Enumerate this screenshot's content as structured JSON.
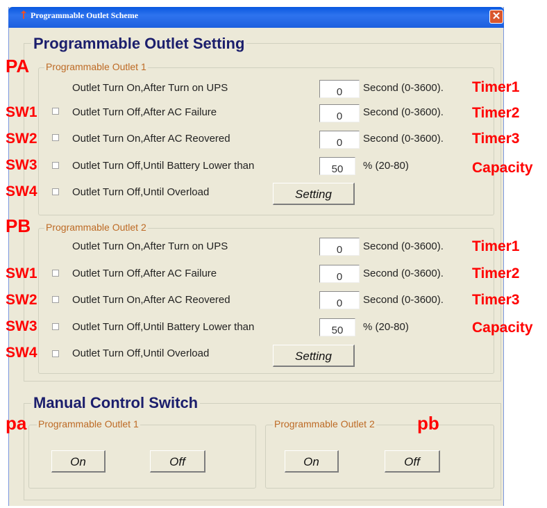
{
  "window": {
    "title": "Programmable Outlet Scheme",
    "close_glyph": "✕"
  },
  "setting": {
    "heading": "Programmable Outlet Setting",
    "outlets": [
      {
        "group_label": "Programmable Outlet 1",
        "turn_on_label": "Outlet Turn On,After Turn on UPS",
        "turn_on_value": "0",
        "turn_on_unit": "Second (0-3600).",
        "ac_fail_label": "Outlet Turn Off,After AC Failure",
        "ac_fail_value": "0",
        "ac_fail_unit": "Second (0-3600).",
        "ac_recover_label": "Outlet Turn On,After AC Reovered",
        "ac_recover_value": "0",
        "ac_recover_unit": "Second (0-3600).",
        "battery_label": "Outlet Turn Off,Until Battery Lower than",
        "battery_value": "50",
        "battery_unit": "% (20-80)",
        "overload_label": "Outlet Turn Off,Until Overload",
        "setting_button": "Setting"
      },
      {
        "group_label": "Programmable Outlet 2",
        "turn_on_label": "Outlet Turn On,After Turn on UPS",
        "turn_on_value": "0",
        "turn_on_unit": "Second (0-3600).",
        "ac_fail_label": "Outlet Turn Off,After AC Failure",
        "ac_fail_value": "0",
        "ac_fail_unit": "Second (0-3600).",
        "ac_recover_label": "Outlet Turn On,After AC Reovered",
        "ac_recover_value": "0",
        "ac_recover_unit": "Second (0-3600).",
        "battery_label": "Outlet Turn Off,Until Battery Lower than",
        "battery_value": "50",
        "battery_unit": "% (20-80)",
        "overload_label": "Outlet Turn Off,Until Overload",
        "setting_button": "Setting"
      }
    ]
  },
  "manual": {
    "heading": "Manual Control Switch",
    "outlets": [
      {
        "group_label": "Programmable Outlet 1",
        "on_button": "On",
        "off_button": "Off"
      },
      {
        "group_label": "Programmable Outlet 2",
        "on_button": "On",
        "off_button": "Off"
      }
    ]
  },
  "annotations": {
    "pa": "PA",
    "pb": "PB",
    "sw1": "SW1",
    "sw2": "SW2",
    "sw3": "SW3",
    "sw4": "SW4",
    "timer1": "Timer1",
    "timer2": "Timer2",
    "timer3": "Timer3",
    "capacity": "Capacity",
    "pa_small": "pa",
    "pb_small": "pb",
    "color": "#ff0000"
  },
  "icons": {
    "app": "outlet-app-icon",
    "close": "close-icon"
  }
}
